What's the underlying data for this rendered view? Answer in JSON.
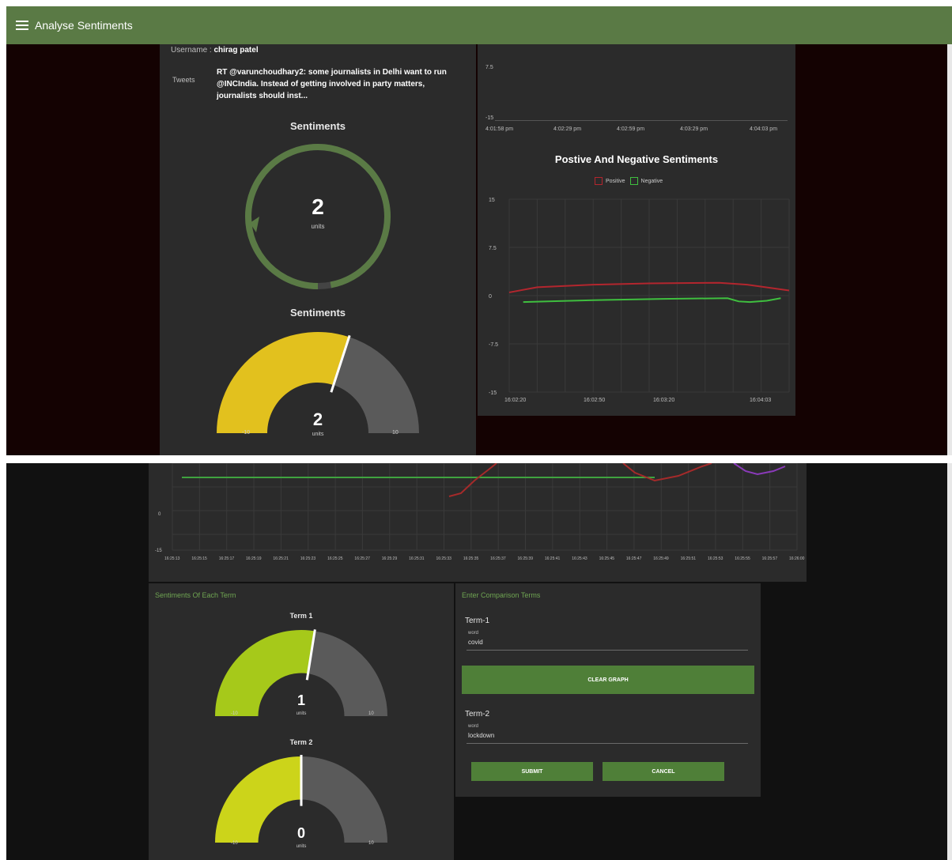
{
  "header": {
    "title": "Analyse Sentiments",
    "menu_icon": "menu-icon"
  },
  "tweet_panel": {
    "username_label": "Username :",
    "username_value": "chirag patel",
    "tweets_label": "Tweets",
    "tweet_text": "RT @varunchoudhary2: some journalists in Delhi want to run @INCIndia. Instead of getting involved in party matters, journalists should inst...",
    "donut": {
      "title": "Sentiments",
      "value": "2",
      "units": "units",
      "fraction": 0.97
    },
    "gauge": {
      "title": "Sentiments",
      "value": "2",
      "units": "units",
      "min": "-10",
      "max": "10",
      "fraction": 0.6
    }
  },
  "top_chart": {
    "ytick_top": "7.5",
    "ytick_bottom": "-15",
    "xticks": [
      "4:01:58 pm",
      "4:02:29 pm",
      "4:02:59 pm",
      "4:03:29 pm",
      "4:04:03 pm"
    ]
  },
  "pos_neg_chart": {
    "title": "Postive And Negative Sentiments",
    "legend": [
      "Positive",
      "Negative"
    ],
    "colors": {
      "positive": "#b3262e",
      "negative": "#3fbf3f"
    },
    "yticks": [
      "15",
      "7.5",
      "0",
      "-7.5",
      "-15"
    ],
    "xticks": [
      "16:02:20",
      "16:02:50",
      "16:03:20",
      "16:04:03"
    ]
  },
  "bottom_chart": {
    "ytick_top": "0",
    "ytick_bottom": "-15",
    "xticks": [
      "16:25:13",
      "16:25:15",
      "16:25:17",
      "16:25:19",
      "16:25:21",
      "16:25:23",
      "16:25:25",
      "16:25:27",
      "16:25:29",
      "16:25:31",
      "16:25:33",
      "16:25:35",
      "16:25:37",
      "16:25:39",
      "16:25:41",
      "16:25:43",
      "16:25:45",
      "16:25:47",
      "16:25:49",
      "16:25:51",
      "16:25:53",
      "16:25:55",
      "16:25:57",
      "16:26:00"
    ]
  },
  "terms_panel": {
    "title": "Sentiments Of Each Term",
    "term1": {
      "title": "Term 1",
      "value": "1",
      "units": "units",
      "min": "-10",
      "max": "10",
      "fraction": 0.55
    },
    "term2": {
      "title": "Term 2",
      "value": "0",
      "units": "units",
      "min": "-10",
      "max": "10",
      "fraction": 0.5
    }
  },
  "comparison_panel": {
    "title": "Enter Comparison Terms",
    "term1_label": "Term-1",
    "term1_caption": "word",
    "term1_value": "covid",
    "term2_label": "Term-2",
    "term2_caption": "word",
    "term2_value": "lockdown",
    "submit_label": "SUBMIT",
    "cancel_label": "CANCEL",
    "clear_label": "CLEAR GRAPH"
  }
}
